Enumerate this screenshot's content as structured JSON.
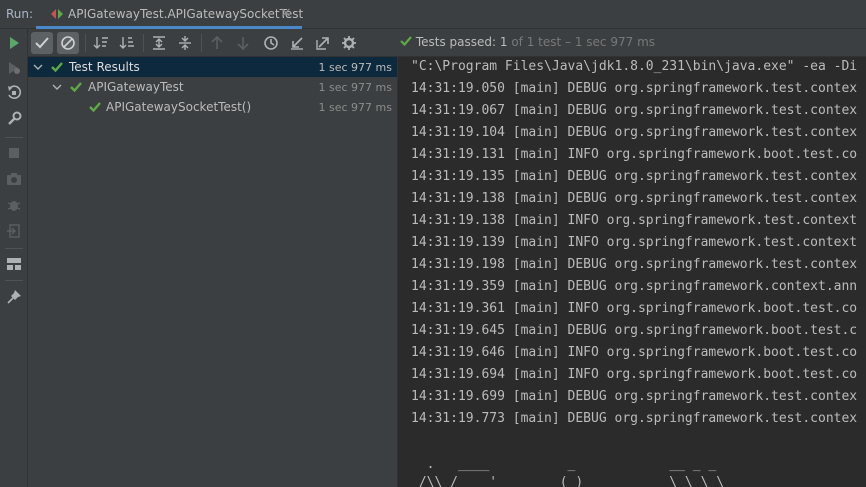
{
  "run": {
    "label": "Run:",
    "tab_title": "APIGatewayTest.APIGatewaySocketTest",
    "tab_close": "×"
  },
  "status": {
    "passed_label": "Tests passed:",
    "count": "1",
    "rest": "of 1 test – 1 sec 977 ms"
  },
  "tree": {
    "items": [
      {
        "label": "Test Results",
        "time": "1 sec 977 ms"
      },
      {
        "label": "APIGatewayTest",
        "time": "1 sec 977 ms"
      },
      {
        "label": "APIGatewaySocketTest()",
        "time": "1 sec 977 ms"
      }
    ]
  },
  "console": {
    "lines": [
      "\"C:\\Program Files\\Java\\jdk1.8.0_231\\bin\\java.exe\" -ea -Di",
      "14:31:19.050 [main] DEBUG org.springframework.test.contex",
      "14:31:19.067 [main] DEBUG org.springframework.test.contex",
      "14:31:19.104 [main] DEBUG org.springframework.test.contex",
      "14:31:19.131 [main] INFO org.springframework.boot.test.co",
      "14:31:19.135 [main] DEBUG org.springframework.test.contex",
      "14:31:19.138 [main] DEBUG org.springframework.test.contex",
      "14:31:19.138 [main] INFO org.springframework.test.context",
      "14:31:19.139 [main] INFO org.springframework.test.context",
      "14:31:19.198 [main] DEBUG org.springframework.test.contex",
      "14:31:19.359 [main] DEBUG org.springframework.context.ann",
      "14:31:19.361 [main] INFO org.springframework.boot.test.co",
      "14:31:19.645 [main] DEBUG org.springframework.boot.test.c",
      "14:31:19.646 [main] INFO org.springframework.boot.test.co",
      "14:31:19.694 [main] INFO org.springframework.boot.test.co",
      "14:31:19.699 [main] DEBUG org.springframework.test.contex",
      "14:31:19.773 [main] DEBUG org.springframework.test.contex",
      "",
      "",
      "  .   ____          _            __ _ _",
      " /\\\\ / ___'_ __ _ _(_)_ __  __ _ \\ \\ \\ \\"
    ]
  },
  "colors": {
    "pass_green": "#5faa47",
    "selection": "#0d293e",
    "tab_underline": "#4a88c7"
  },
  "icons": {
    "left_toolbar": [
      "rerun-icon",
      "rerun-failed-icon",
      "toggle-auto-test-icon",
      "settings-wrench-icon",
      "stop-icon",
      "screenshot-icon",
      "debug-icon",
      "exit-icon",
      "layout-icon",
      "pin-icon"
    ],
    "test_toolbar": [
      "show-passed-icon",
      "show-ignored-icon",
      "sort-alpha-icon",
      "sort-duration-icon",
      "expand-all-icon",
      "collapse-all-icon",
      "prev-failed-icon",
      "next-failed-icon",
      "history-icon",
      "import-tests-icon",
      "export-tests-icon",
      "test-settings-icon"
    ]
  }
}
